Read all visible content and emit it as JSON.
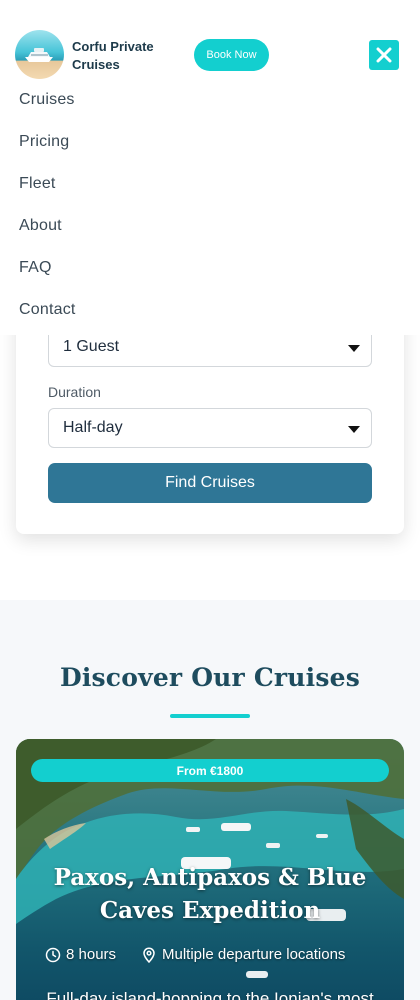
{
  "header": {
    "brand": "Corfu Private Cruises",
    "book_label": "Book Now"
  },
  "nav": {
    "items": [
      "Cruises",
      "Pricing",
      "Fleet",
      "About",
      "FAQ",
      "Contact"
    ]
  },
  "booking": {
    "guests_value": "1 Guest",
    "duration_label": "Duration",
    "duration_value": "Half-day",
    "find_label": "Find Cruises"
  },
  "discover": {
    "title": "Discover Our Cruises",
    "card": {
      "price": "From €1800",
      "title": "Paxos, Antipaxos & Blue Caves Expedition",
      "duration": "8 hours",
      "departure": "Multiple departure locations",
      "description": "Full-day island-hopping to the Ionian's most"
    }
  },
  "colors": {
    "accent": "#13cfcf",
    "primary_button": "#2f7696",
    "heading": "#1e4c5e"
  }
}
